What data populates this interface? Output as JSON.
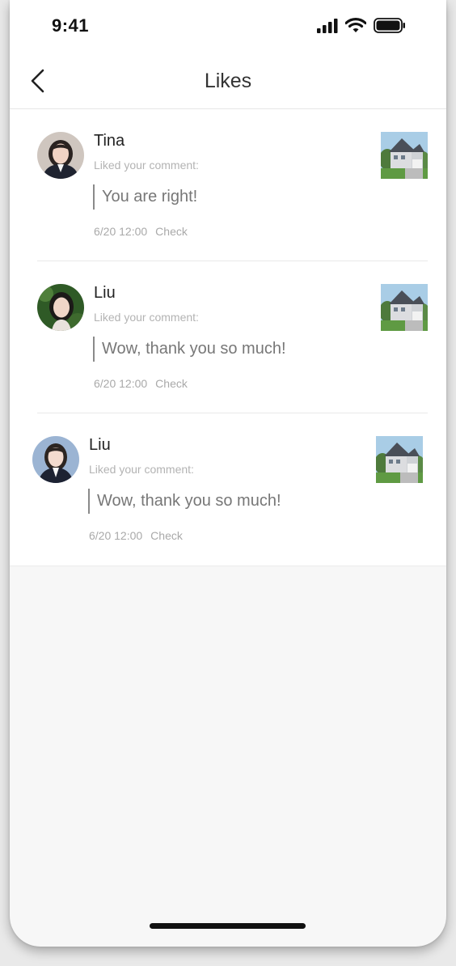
{
  "status_bar": {
    "time": "9:41",
    "icons": [
      "cellular-signal-icon",
      "wifi-icon",
      "battery-icon"
    ]
  },
  "nav": {
    "back_icon": "chevron-left-icon",
    "title": "Likes"
  },
  "likes": [
    {
      "user": "Tina",
      "label": "Liked your comment:",
      "comment": "You are right!",
      "time": "6/20 12:00",
      "action": "Check",
      "avatar_icon": "user-avatar",
      "thumbnail_icon": "house-thumbnail"
    },
    {
      "user": "Liu",
      "label": "Liked your comment:",
      "comment": "Wow, thank you so much!",
      "time": "6/20 12:00",
      "action": "Check",
      "avatar_icon": "user-avatar",
      "thumbnail_icon": "house-thumbnail"
    },
    {
      "user": "Liu",
      "label": "Liked your comment:",
      "comment": "Wow, thank you so much!",
      "time": "6/20 12:00",
      "action": "Check",
      "avatar_icon": "user-avatar",
      "thumbnail_icon": "house-thumbnail"
    }
  ],
  "colors": {
    "background": "#f7f7f7",
    "card": "#ffffff",
    "title": "#333333",
    "secondary_text": "#b3b3b3",
    "quote_bar": "#8a8a8a"
  }
}
